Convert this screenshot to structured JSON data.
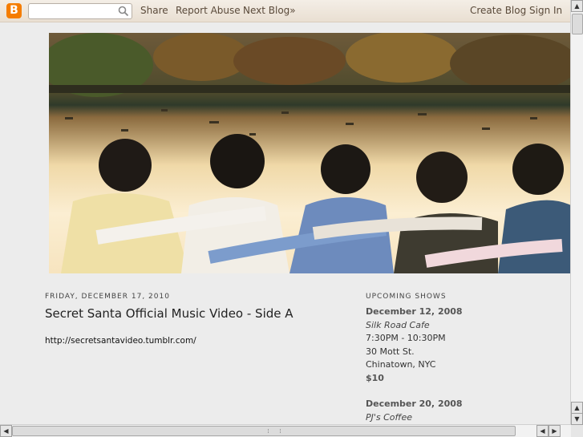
{
  "navbar": {
    "logo_letter": "B",
    "search_placeholder": "",
    "links": [
      "Share",
      "Report Abuse",
      "Next Blog»"
    ],
    "right_links": [
      "Create Blog",
      "Sign In"
    ]
  },
  "post": {
    "date": "Friday, December 17, 2010",
    "title": "Secret Santa Official Music Video - Side A",
    "body": "http://secretsantavideo.tumblr.com/"
  },
  "sidebar": {
    "title": "Upcoming Shows",
    "shows": [
      {
        "date": "December 12, 2008",
        "venue": "Silk Road Cafe",
        "time": "7:30PM - 10:30PM",
        "address": "30 Mott St.",
        "city": "Chinatown, NYC",
        "price": "$10"
      },
      {
        "date": "December 20, 2008",
        "venue": "PJ's Coffee"
      }
    ]
  },
  "colors": {
    "accent": "#f57d00",
    "background": "#ececec"
  }
}
